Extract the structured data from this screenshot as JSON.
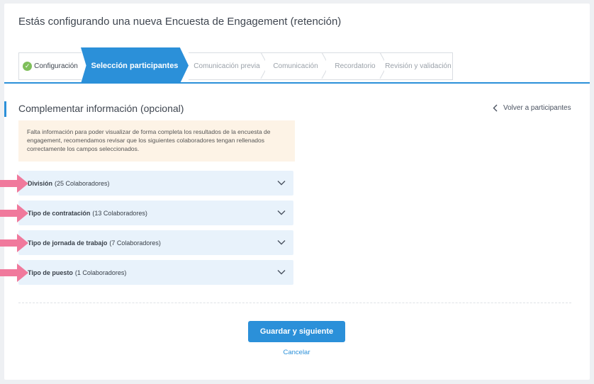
{
  "page": {
    "title": "Estás configurando una nueva Encuesta de Engagement (retención)"
  },
  "stepper": {
    "steps": [
      {
        "label": "Configuración",
        "state": "completed"
      },
      {
        "label": "Selección participantes",
        "state": "active"
      },
      {
        "label": "Comunicación previa",
        "state": "pending"
      },
      {
        "label": "Comunicación",
        "state": "pending"
      },
      {
        "label": "Recordatorio",
        "state": "pending"
      },
      {
        "label": "Revisión y validación",
        "state": "pending"
      }
    ]
  },
  "section": {
    "title": "Complementar información (opcional)",
    "back_link": "Volver a participantes"
  },
  "alert": {
    "text": "Falta información para poder visualizar de forma completa los resultados de la encuesta de engagement, recomendamos revisar que los siguientes colaboradores tengan rellenados correctamente los campos seleccionados."
  },
  "accordion": [
    {
      "field": "División",
      "count": "(25 Colaboradores)"
    },
    {
      "field": "Tipo de contratación",
      "count": "(13 Colaboradores)"
    },
    {
      "field": "Tipo de jornada de trabajo",
      "count": "(7 Colaboradores)"
    },
    {
      "field": "Tipo de puesto",
      "count": "(1 Colaboradores)"
    }
  ],
  "actions": {
    "primary": "Guardar y siguiente",
    "cancel": "Cancelar"
  },
  "colors": {
    "accent": "#2b90d9",
    "alert_bg": "#fdf3e6",
    "accordion_bg": "#e8f2fb",
    "annotation_arrow": "#f0799c",
    "completed_check": "#7fbf5b"
  },
  "icons": {
    "completed_step": "check-circle-icon",
    "back": "chevron-left-icon",
    "expand": "chevron-down-icon",
    "annotation": "pink-arrow-icon"
  }
}
